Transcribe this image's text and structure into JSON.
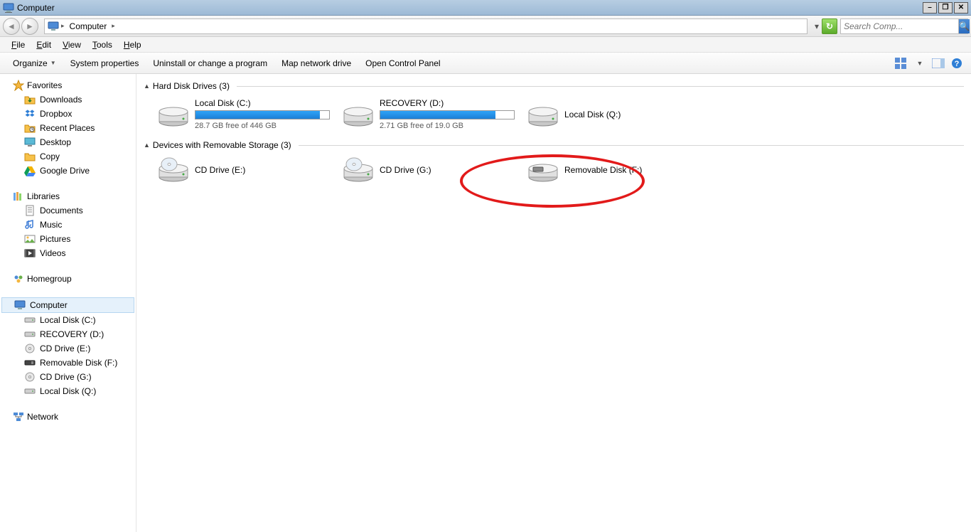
{
  "titlebar": {
    "title": "Computer"
  },
  "address": {
    "location": "Computer"
  },
  "search": {
    "placeholder": "Search Comp..."
  },
  "menubar": [
    "File",
    "Edit",
    "View",
    "Tools",
    "Help"
  ],
  "cmdbar": {
    "organize": "Organize",
    "items": [
      "System properties",
      "Uninstall or change a program",
      "Map network drive",
      "Open Control Panel"
    ]
  },
  "sidebar": {
    "favorites": {
      "label": "Favorites",
      "items": [
        "Downloads",
        "Dropbox",
        "Recent Places",
        "Desktop",
        "Copy",
        "Google Drive"
      ]
    },
    "libraries": {
      "label": "Libraries",
      "items": [
        "Documents",
        "Music",
        "Pictures",
        "Videos"
      ]
    },
    "homegroup": {
      "label": "Homegroup"
    },
    "computer": {
      "label": "Computer",
      "items": [
        "Local Disk (C:)",
        "RECOVERY (D:)",
        "CD Drive (E:)",
        "Removable Disk (F:)",
        "CD Drive (G:)",
        "Local Disk (Q:)"
      ]
    },
    "network": {
      "label": "Network"
    }
  },
  "main": {
    "sections": {
      "hdd": {
        "header": "Hard Disk Drives (3)"
      },
      "removable": {
        "header": "Devices with Removable Storage (3)"
      }
    },
    "drives": {
      "c": {
        "name": "Local Disk (C:)",
        "free": "28.7 GB free of 446 GB",
        "fillPct": 93
      },
      "d": {
        "name": "RECOVERY (D:)",
        "free": "2.71 GB free of 19.0 GB",
        "fillPct": 86
      },
      "q": {
        "name": "Local Disk (Q:)"
      },
      "e": {
        "name": "CD Drive (E:)"
      },
      "g": {
        "name": "CD Drive (G:)"
      },
      "f": {
        "name": "Removable Disk (F:)"
      }
    }
  }
}
